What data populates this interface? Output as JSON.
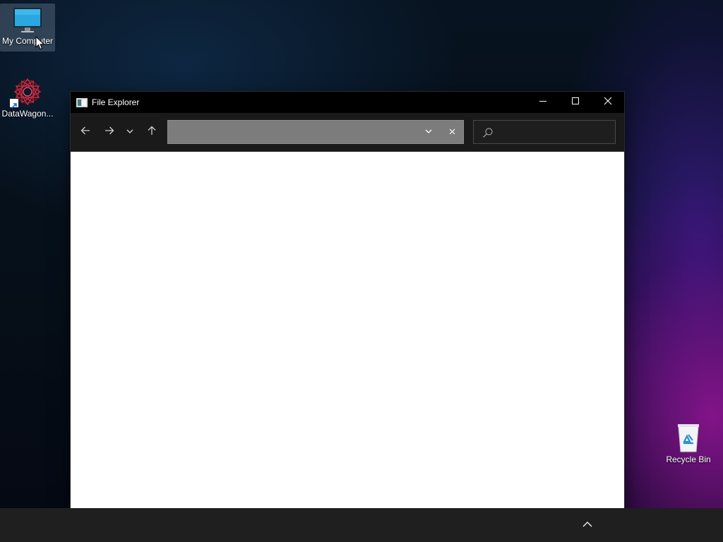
{
  "desktop": {
    "icons": [
      {
        "label": "My Computer",
        "icon": "monitor-icon",
        "selected": true
      },
      {
        "label": "DataWagon...",
        "icon": "datawagon-app-icon",
        "shortcut": true
      },
      {
        "label": "Recycle Bin",
        "icon": "recycle-bin-icon"
      }
    ]
  },
  "window": {
    "title": "File Explorer",
    "controls": [
      "minimize-icon",
      "maximize-icon",
      "close-icon"
    ],
    "toolbar": {
      "buttons": [
        "back-arrow-icon",
        "forward-arrow-icon",
        "recent-locations-chevron-icon",
        "up-arrow-icon"
      ],
      "address": {
        "value": "",
        "placeholder": ""
      },
      "search": {
        "value": "",
        "placeholder": ""
      }
    }
  },
  "taskbar": {
    "tray": [
      "show-hidden-icons-chevron-icon"
    ]
  },
  "colors": {
    "titlebar": "#000000",
    "toolbar": "#1a1a1a",
    "address_bar": "#7c7c7c",
    "taskbar": "#1f1f1f",
    "content": "#ffffff"
  }
}
